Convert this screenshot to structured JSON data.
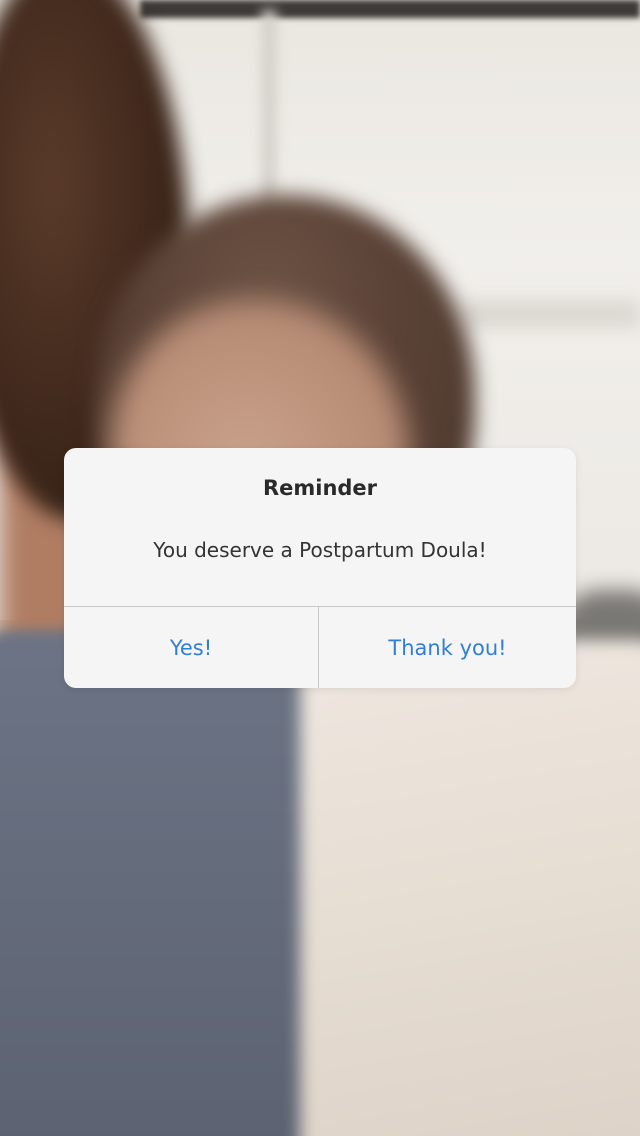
{
  "background": {
    "description_icon": "photo-background"
  },
  "dialog": {
    "title": "Reminder",
    "message": "You deserve a Postpartum Doula!",
    "buttons": {
      "yes_label": "Yes!",
      "thank_you_label": "Thank you!"
    }
  },
  "colors": {
    "dialog_background": "#f5f5f5",
    "button_text": "#2f7fd8",
    "title_text": "#2a2a2a",
    "divider": "#c9c9c9"
  }
}
